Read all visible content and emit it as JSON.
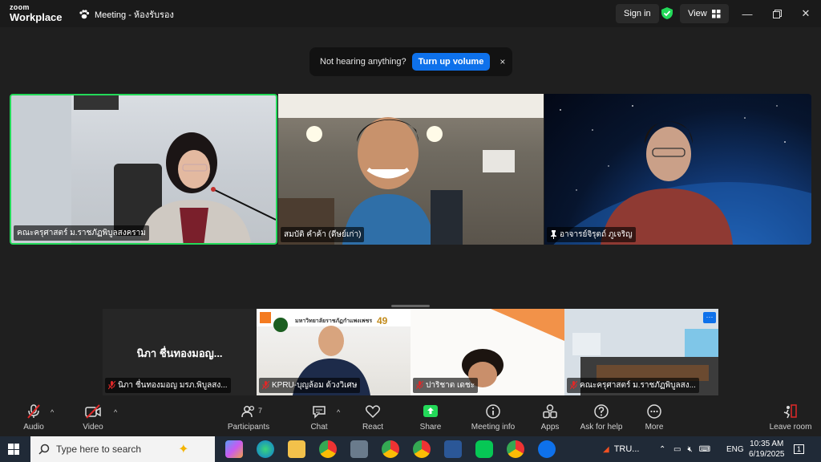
{
  "titlebar": {
    "logo_top": "zoom",
    "logo_bottom": "Workplace",
    "meeting_title": "Meeting - ห้องรับรอง",
    "sign_in": "Sign in",
    "view": "View"
  },
  "notice": {
    "message": "Not hearing anything?",
    "button": "Turn up volume",
    "close": "×"
  },
  "tiles": {
    "t1_name": "คณะครุศาสตร์ ม.ราชภัฏพิบูลสงคราม",
    "t2_name": "สมบัติ คำค้า (ดีษย์เก่า)",
    "t3_name": "อาจารย์จิรุตถ์ ภูเจริญ",
    "t4_big": "นิภา ชื่นทองมอญ...",
    "t4_name": "นิภา ชื่นทองมอญ  มรภ.พิบูลสง...",
    "t5_name": "KPRU-บุญล้อม ด้วงวิเศษ",
    "t6_name": "ปาริชาต เดชะ",
    "t7_name": "คณะครุศาสตร์ ม.ราชภัฏพิบูลสง...",
    "t5_banner": "มหาวิทยาลัยราชภัฏกำแพงเพชร",
    "t5_anniv": "49"
  },
  "toolbar": {
    "audio": "Audio",
    "video": "Video",
    "participants": "Participants",
    "participants_count": "7",
    "chat": "Chat",
    "react": "React",
    "share": "Share",
    "meeting_info": "Meeting info",
    "apps": "Apps",
    "help": "Ask for help",
    "more": "More",
    "leave": "Leave room"
  },
  "taskbar": {
    "search_placeholder": "Type here to search",
    "tru": "TRU...",
    "lang": "ENG",
    "time": "10:35 AM",
    "date": "6/19/2025",
    "notif_count": "1"
  },
  "colors": {
    "zoom_blue": "#0e71eb",
    "active_speaker": "#23d959",
    "share_green": "#23d959"
  }
}
